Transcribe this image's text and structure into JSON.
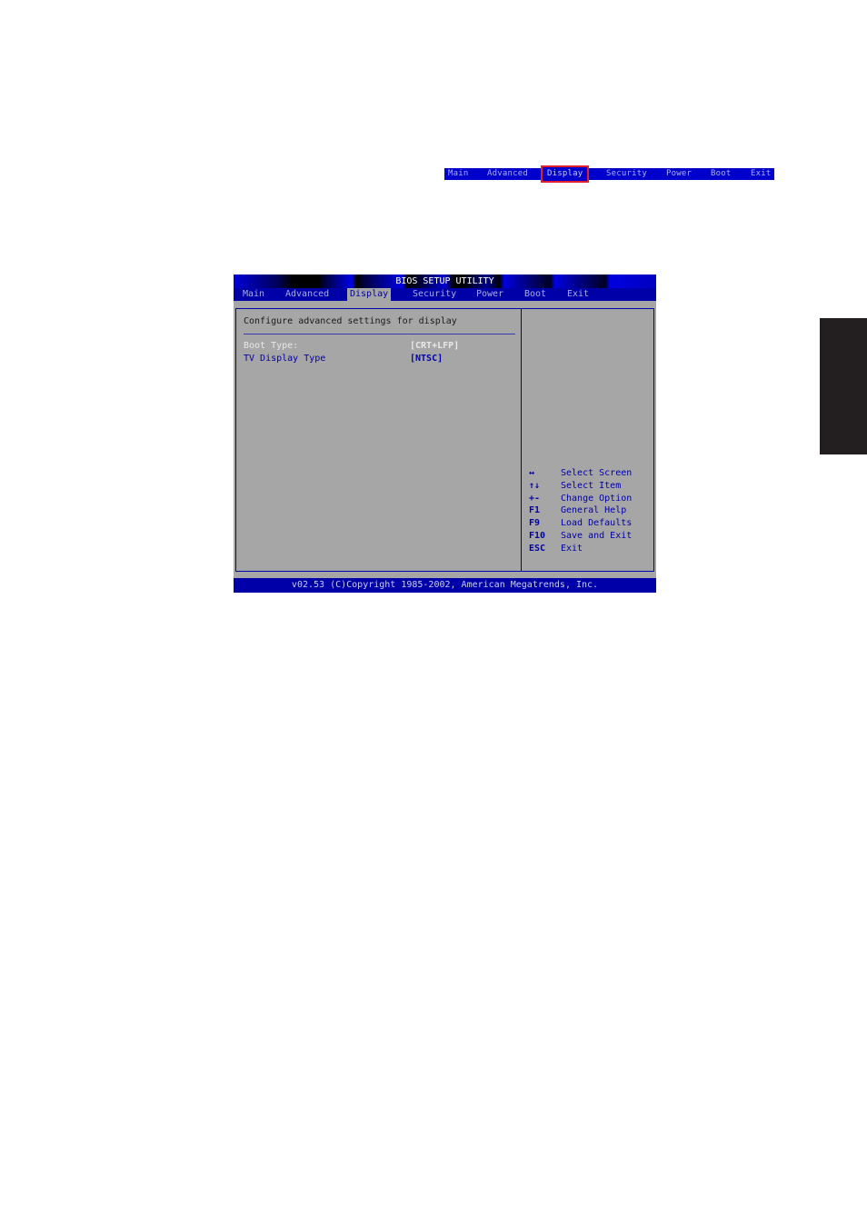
{
  "mini_menu": {
    "items": [
      {
        "label": "Main",
        "active": false
      },
      {
        "label": "Advanced",
        "active": false
      },
      {
        "label": "Display",
        "active": true
      },
      {
        "label": "Security",
        "active": false
      },
      {
        "label": "Power",
        "active": false
      },
      {
        "label": "Boot",
        "active": false
      },
      {
        "label": "Exit",
        "active": false
      }
    ],
    "highlight_color": "#e0202a"
  },
  "bios": {
    "title": "BIOS SETUP UTILITY",
    "tabs": [
      {
        "label": "Main",
        "active": false
      },
      {
        "label": "Advanced",
        "active": false
      },
      {
        "label": "Display",
        "active": true
      },
      {
        "label": "Security",
        "active": false
      },
      {
        "label": "Power",
        "active": false
      },
      {
        "label": "Boot",
        "active": false
      },
      {
        "label": "Exit",
        "active": false
      }
    ],
    "description": "Configure advanced settings for display",
    "options": [
      {
        "label": "Boot Type:",
        "value": "[CRT+LFP]",
        "selectable": false
      },
      {
        "label": "TV Display Type",
        "value": "[NTSC]",
        "selectable": true
      }
    ],
    "help": [
      {
        "key": "↔",
        "action": "Select Screen"
      },
      {
        "key": "↑↓",
        "action": "Select Item"
      },
      {
        "key": "+-",
        "action": "Change Option"
      },
      {
        "key": "F1",
        "action": "General Help"
      },
      {
        "key": "F9",
        "action": "Load Defaults"
      },
      {
        "key": "F10",
        "action": "Save and Exit"
      },
      {
        "key": "ESC",
        "action": "Exit"
      }
    ],
    "footer": "v02.53 (C)Copyright 1985-2002, American Megatrends, Inc.",
    "colors": {
      "blue": "#0000a8",
      "gray": "#a6a6a6"
    }
  }
}
